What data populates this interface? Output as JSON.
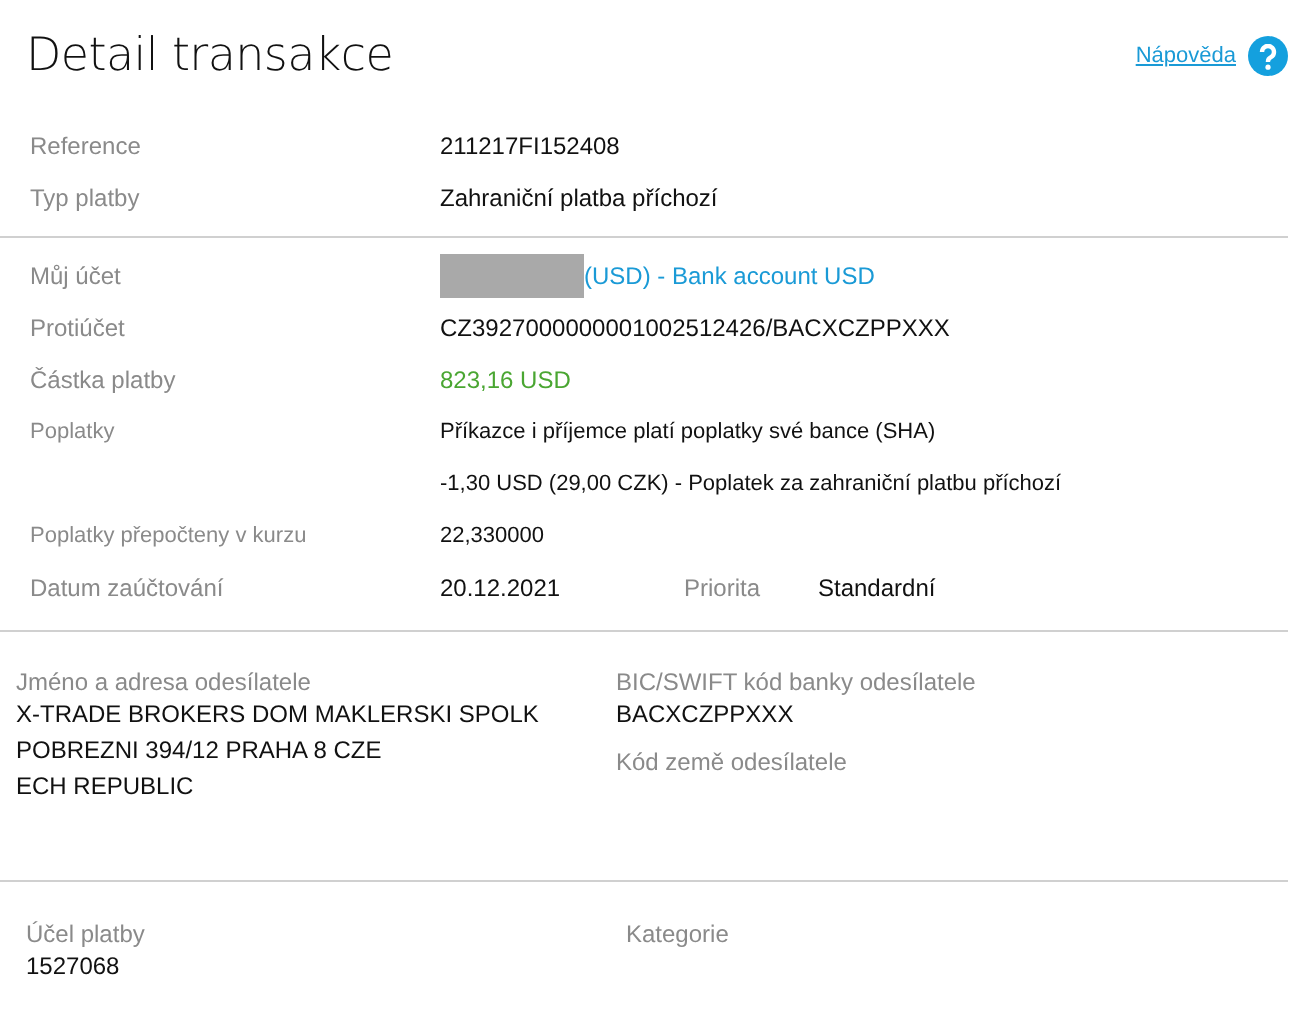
{
  "header": {
    "title": "Detail transakce",
    "help_link": "Nápověda"
  },
  "summary": [
    {
      "kind": "plain",
      "label": "Reference",
      "value": "211217FI152408"
    },
    {
      "kind": "plain",
      "label": "Typ platby",
      "value": "Zahraniční platba příchozí"
    }
  ],
  "details": [
    {
      "kind": "account",
      "label": "Můj účet",
      "value": "(USD) - Bank account USD"
    },
    {
      "kind": "plain",
      "label": "Protiúčet",
      "value": "CZ3927000000001002512426/BACXCZPPXXX"
    },
    {
      "kind": "amount",
      "label": "Částka platby",
      "value": "823,16 USD"
    },
    {
      "kind": "small",
      "label": "Poplatky",
      "value": "Příkazce i příjemce platí poplatky své bance (SHA)"
    },
    {
      "kind": "small",
      "value": "-1,30 USD (29,00 CZK) - Poplatek za zahraniční platbu příchozí"
    },
    {
      "kind": "small",
      "label": "Poplatky přepočteny v kurzu",
      "value": "22,330000"
    },
    {
      "kind": "priority",
      "label": "Datum zaúčtování",
      "value": "20.12.2021",
      "extra_label": "Priorita",
      "extra_value": "Standardní"
    }
  ],
  "sender": {
    "left": {
      "label": "Jméno a adresa odesílatele",
      "lines": [
        "X-TRADE BROKERS DOM MAKLERSKI SPOLK",
        "POBREZNI 394/12 PRAHA 8 CZE",
        "ECH REPUBLIC"
      ]
    },
    "right": [
      {
        "label": "BIC/SWIFT kód banky odesílatele",
        "value": "BACXCZPPXXX"
      },
      {
        "label": "Kód země odesílatele"
      }
    ]
  },
  "purpose": {
    "label": "Účel platby",
    "value": "1527068",
    "category_label": "Kategorie"
  }
}
